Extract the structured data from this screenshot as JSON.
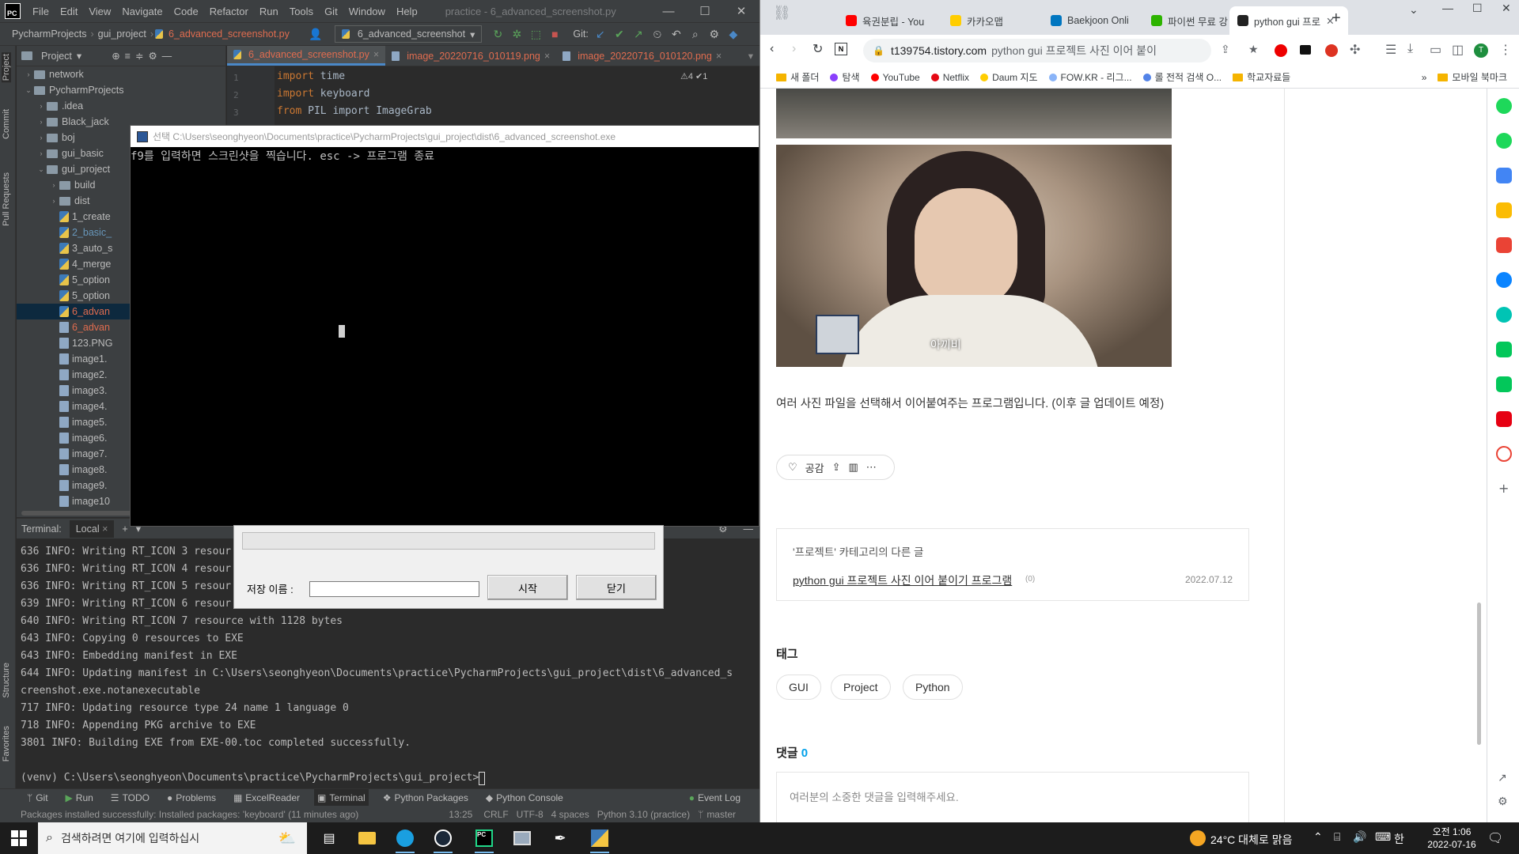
{
  "ide": {
    "menu": [
      "File",
      "Edit",
      "View",
      "Navigate",
      "Code",
      "Refactor",
      "Run",
      "Tools",
      "Git",
      "Window",
      "Help"
    ],
    "title": "practice - 6_advanced_screenshot.py",
    "breadcrumb": [
      "PycharmProjects",
      "gui_project",
      "6_advanced_screenshot.py"
    ],
    "run_config": "6_advanced_screenshot",
    "git_label": "Git:",
    "project_label": "Project",
    "side_tabs": [
      "Project",
      "Commit",
      "Pull Requests",
      "Structure",
      "Favorites"
    ],
    "tree": [
      {
        "label": "network",
        "type": "folder",
        "depth": 1,
        "arrow": "›"
      },
      {
        "label": "PycharmProjects",
        "type": "folder",
        "depth": 1,
        "arrow": "⌄"
      },
      {
        "label": ".idea",
        "type": "folder",
        "depth": 2,
        "arrow": "›"
      },
      {
        "label": "Black_jack",
        "type": "folder",
        "depth": 2,
        "arrow": "›"
      },
      {
        "label": "boj",
        "type": "folder",
        "depth": 2,
        "arrow": "›"
      },
      {
        "label": "gui_basic",
        "type": "folder",
        "depth": 2,
        "arrow": "›"
      },
      {
        "label": "gui_project",
        "type": "folder",
        "depth": 2,
        "arrow": "⌄"
      },
      {
        "label": "build",
        "type": "folder",
        "depth": 3,
        "arrow": "›"
      },
      {
        "label": "dist",
        "type": "folder",
        "depth": 3,
        "arrow": "›"
      },
      {
        "label": "1_create",
        "type": "py",
        "depth": 3,
        "arrow": ""
      },
      {
        "label": "2_basic_",
        "type": "py",
        "depth": 3,
        "arrow": "",
        "color": "blue"
      },
      {
        "label": "3_auto_s",
        "type": "py",
        "depth": 3,
        "arrow": ""
      },
      {
        "label": "4_merge",
        "type": "py",
        "depth": 3,
        "arrow": ""
      },
      {
        "label": "5_option",
        "type": "py",
        "depth": 3,
        "arrow": ""
      },
      {
        "label": "5_option",
        "type": "py",
        "depth": 3,
        "arrow": ""
      },
      {
        "label": "6_advan",
        "type": "py",
        "depth": 3,
        "arrow": "",
        "color": "red",
        "selected": true
      },
      {
        "label": "6_advan",
        "type": "png",
        "depth": 3,
        "arrow": "",
        "color": "red"
      },
      {
        "label": "123.PNG",
        "type": "png",
        "depth": 3,
        "arrow": ""
      },
      {
        "label": "image1.",
        "type": "png",
        "depth": 3,
        "arrow": ""
      },
      {
        "label": "image2.",
        "type": "png",
        "depth": 3,
        "arrow": ""
      },
      {
        "label": "image3.",
        "type": "png",
        "depth": 3,
        "arrow": ""
      },
      {
        "label": "image4.",
        "type": "png",
        "depth": 3,
        "arrow": ""
      },
      {
        "label": "image5.",
        "type": "png",
        "depth": 3,
        "arrow": ""
      },
      {
        "label": "image6.",
        "type": "png",
        "depth": 3,
        "arrow": ""
      },
      {
        "label": "image7.",
        "type": "png",
        "depth": 3,
        "arrow": ""
      },
      {
        "label": "image8.",
        "type": "png",
        "depth": 3,
        "arrow": ""
      },
      {
        "label": "image9.",
        "type": "png",
        "depth": 3,
        "arrow": ""
      },
      {
        "label": "image10",
        "type": "png",
        "depth": 3,
        "arrow": ""
      }
    ],
    "editor_tabs": [
      "6_advanced_screenshot.py",
      "image_20220716_010119.png",
      "image_20220716_010120.png"
    ],
    "inspection": "⚠4 ✔1",
    "code_lines": [
      {
        "n": "1",
        "kw": "import",
        "rest": " time"
      },
      {
        "n": "2",
        "kw": "import",
        "rest": " keyboard"
      },
      {
        "n": "3",
        "kw": "from",
        "rest": " PIL import ImageGrab"
      }
    ],
    "terminal_label": "Terminal:",
    "terminal_tab": "Local",
    "terminal_lines": [
      "636 INFO: Writing RT_ICON 3 resour",
      "636 INFO: Writing RT_ICON 4 resour",
      "636 INFO: Writing RT_ICON 5 resour",
      "639 INFO: Writing RT_ICON 6 resour",
      "640 INFO: Writing RT_ICON 7 resource with 1128 bytes",
      "643 INFO: Copying 0 resources to EXE",
      "643 INFO: Embedding manifest in EXE",
      "644 INFO: Updating manifest in C:\\Users\\seonghyeon\\Documents\\practice\\PycharmProjects\\gui_project\\dist\\6_advanced_s",
      "creenshot.exe.notanexecutable",
      "717 INFO: Updating resource type 24 name 1 language 0",
      "718 INFO: Appending PKG archive to EXE",
      "3801 INFO: Building EXE from EXE-00.toc completed successfully.",
      "",
      "(venv) C:\\Users\\seonghyeon\\Documents\\practice\\PycharmProjects\\gui_project>"
    ],
    "tool_tabs": [
      "Git",
      "Run",
      "TODO",
      "Problems",
      "ExcelReader",
      "Terminal",
      "Python Packages",
      "Python Console",
      "Event Log"
    ],
    "status_message": "Packages installed successfully: Installed packages: 'keyboard' (11 minutes ago)",
    "status_right": [
      "13:25",
      "CRLF",
      "UTF-8",
      "4 spaces",
      "Python 3.10 (practice)",
      "master"
    ]
  },
  "console": {
    "title": "선택 C:\\Users\\seonghyeon\\Documents\\practice\\PycharmProjects\\gui_project\\dist\\6_advanced_screenshot.exe",
    "text": "f9를 입력하면 스크린샷을 찍습니다. esc -> 프로그램 종료"
  },
  "dialog": {
    "save_label": "저장 이름 :",
    "save_value": "",
    "start_button": "시작",
    "close_button": "닫기"
  },
  "browser": {
    "tabs": [
      {
        "label": "육권분립 - You",
        "color": "#ff0000"
      },
      {
        "label": "카카오맵",
        "color": "#ffcd00"
      },
      {
        "label": "Baekjoon Onli",
        "color": "#0076c0"
      },
      {
        "label": "파이썬 무료 강",
        "color": "#2db400"
      },
      {
        "label": "python gui 프로",
        "color": "#222222",
        "active": true
      }
    ],
    "url_domain": "t139754.tistory.com",
    "url_rest": "python gui 프로젝트 사진 이어 붙이",
    "bookmarks": [
      {
        "label": "새 폴더",
        "kind": "folder"
      },
      {
        "label": "탐색",
        "kind": "dot",
        "color": "#8a3ffc"
      },
      {
        "label": "YouTube",
        "kind": "dot",
        "color": "#ff0000"
      },
      {
        "label": "Netflix",
        "kind": "dot",
        "color": "#e50914"
      },
      {
        "label": "Daum 지도",
        "kind": "dot",
        "color": "#ffcd00"
      },
      {
        "label": "FOW.KR - 리그...",
        "kind": "dot",
        "color": "#8ab4f8"
      },
      {
        "label": "롤 전적 검색 O...",
        "kind": "dot",
        "color": "#5383e8"
      },
      {
        "label": "학교자료들",
        "kind": "folder"
      }
    ],
    "bookmarks_more": "»",
    "mobile_bookmarks": "모바일 북마크",
    "photo_caption": "아끼비",
    "post_text": "여러 사진 파일을 선택해서 이어붙여주는 프로그램입니다. (이후 글 업데이트 예정)",
    "like_label": "공감",
    "related_title": "'프로젝트' 카테고리의 다른 글",
    "related_link": "python gui 프로젝트 사진 이어 붙이기 프로그램",
    "related_count": "(0)",
    "related_date": "2022.07.12",
    "tags_heading": "태그",
    "tags": [
      "GUI",
      "Project",
      "Python"
    ],
    "comments_heading": "댓글",
    "comments_count": "0",
    "comment_placeholder": "여러분의 소중한 댓글을 입력해주세요.",
    "accent": "#00a0e9"
  },
  "taskbar": {
    "search_placeholder": "검색하려면 여기에 입력하십시",
    "weather": "24°C  대체로 맑음",
    "ime": "한",
    "time": "오전 1:06",
    "date": "2022-07-16"
  }
}
